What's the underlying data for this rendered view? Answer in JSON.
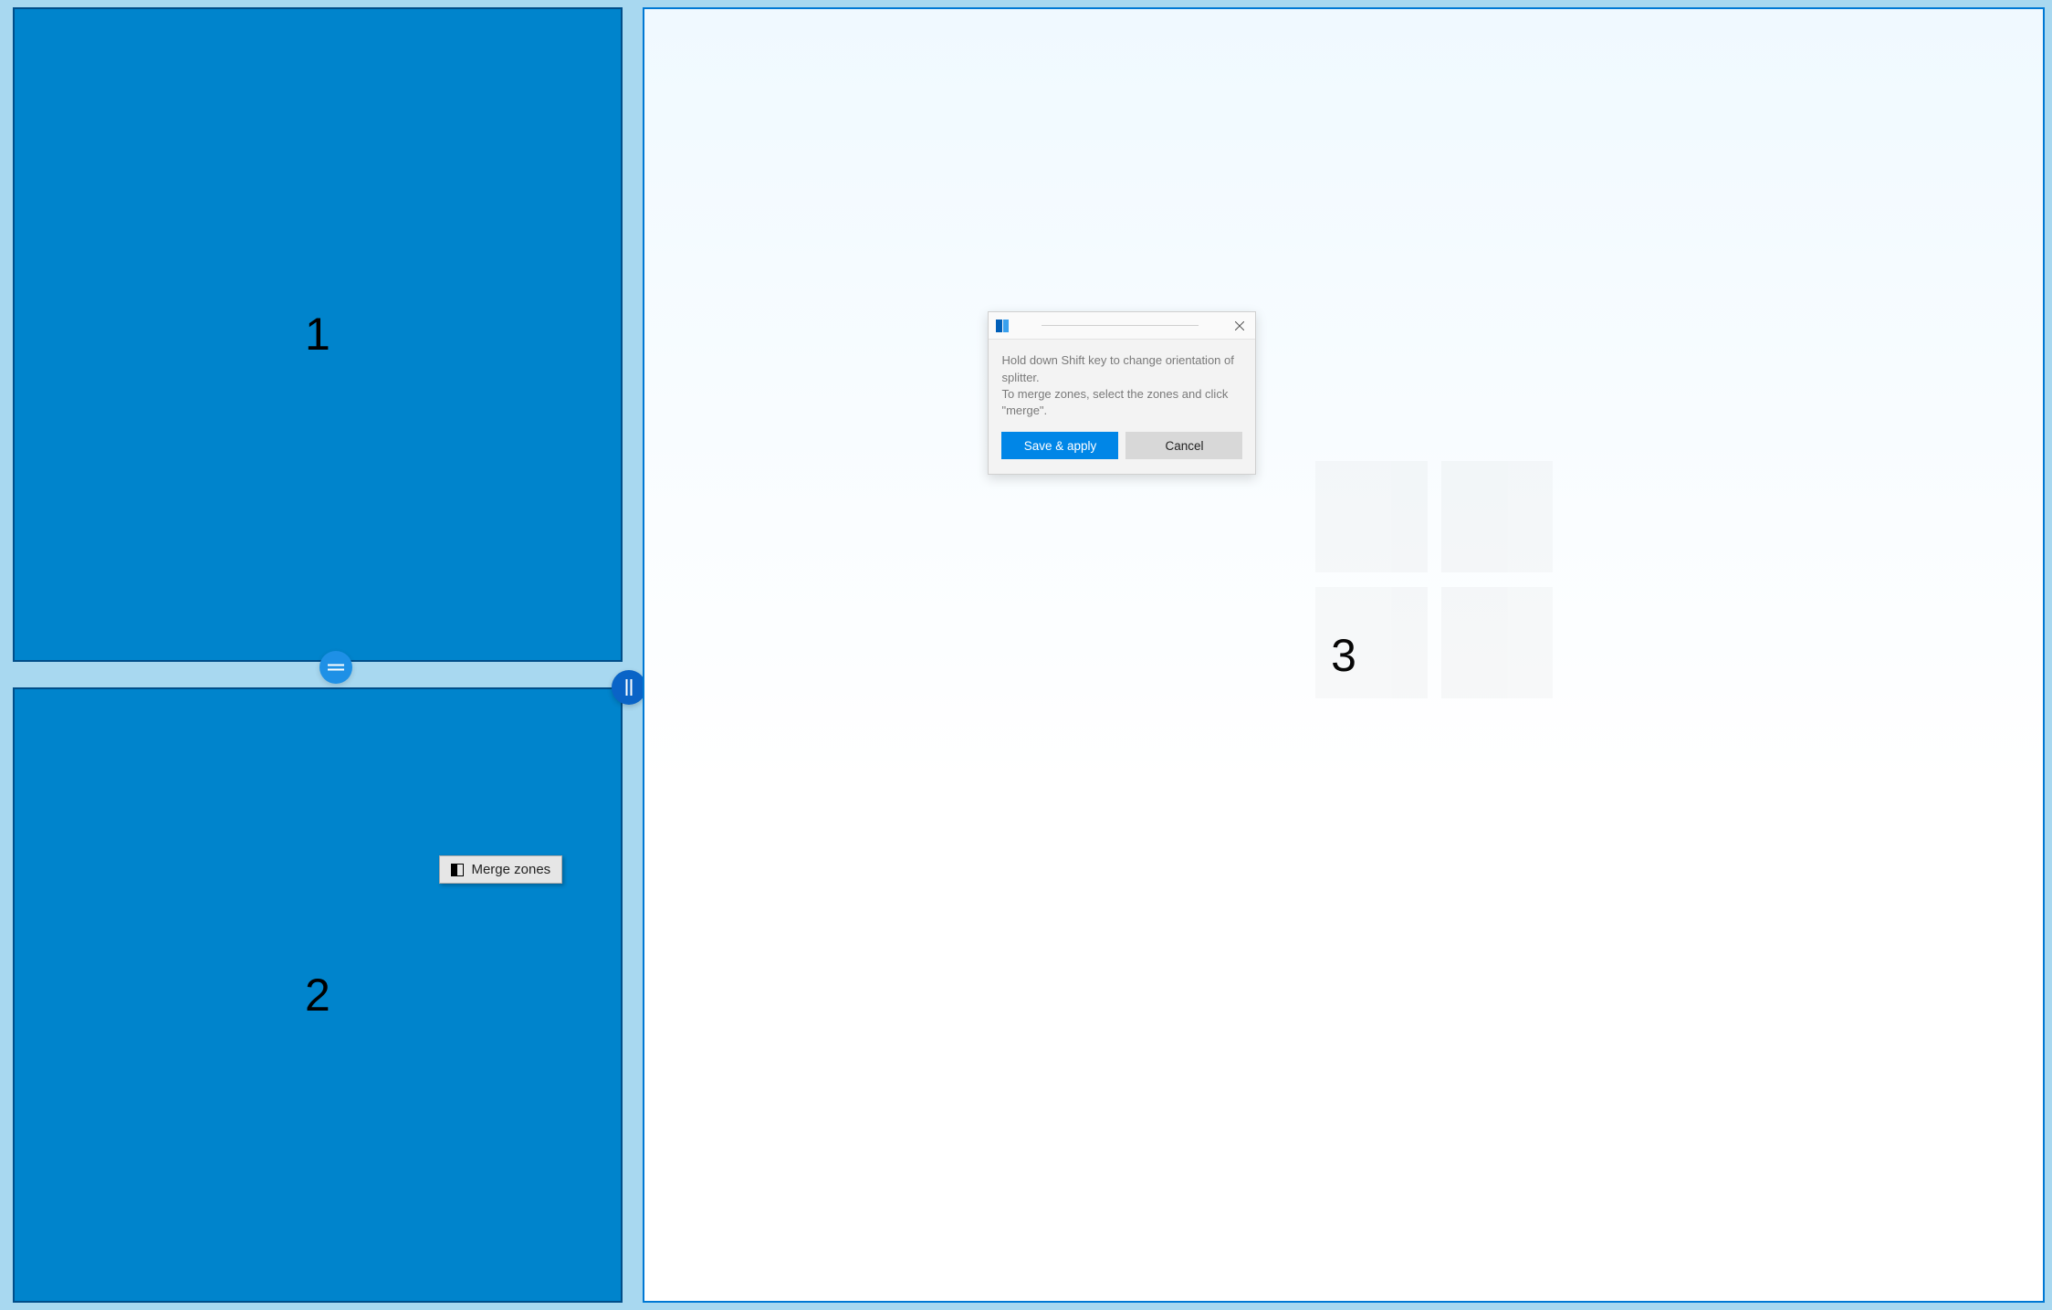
{
  "zones": {
    "z1_label": "1",
    "z2_label": "2",
    "z3_label": "3"
  },
  "merge_button": {
    "label": "Merge zones"
  },
  "dialog": {
    "hint_line1": "Hold down Shift key to change orientation of splitter.",
    "hint_line2": "To merge zones, select the zones and click \"merge\".",
    "save_label": "Save & apply",
    "cancel_label": "Cancel"
  }
}
